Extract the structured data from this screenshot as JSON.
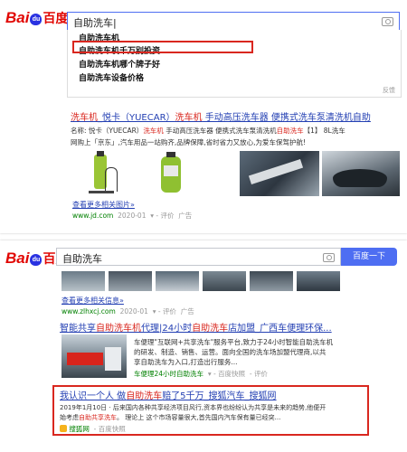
{
  "brand": {
    "latin": "Bai",
    "paw": "du",
    "cn": "百度"
  },
  "panel1": {
    "search_value": "自助洗车|",
    "suggestions": [
      "自助洗车机",
      "自助洗车机千万别投资",
      "自助洗车机哪个牌子好",
      "自助洗车设备价格"
    ],
    "feedback": "反馈",
    "result": {
      "title_red1": "洗车机",
      "title_mid": "_悦卡（YUECAR）",
      "title_red2": "洗车机",
      "title_tail": " 手动高压洗车器 便携式洗车泵清洗机自助",
      "snippet1_a": "名称: 悦卡（YUECAR）",
      "snippet1_red": "洗车机",
      "snippet1_b": " 手动高压洗车器 便携式洗车泵清洗机",
      "snippet1_red2": "自助洗车",
      "snippet1_c": "【1】 8L洗车",
      "snippet2": "网购上「京东」,汽车用品一站购齐,品牌保障,省时省力又放心,为爱车保驾护航!",
      "more_images": "查看更多相关图片»",
      "url": "www.jd.com",
      "date": "2020-01",
      "rating": "评价",
      "ad": "广告"
    }
  },
  "panel2": {
    "search_value": "自助洗车",
    "search_button": "百度一下",
    "more_info": "查看更多相关信息»",
    "url_top": "www.zlhxcj.com",
    "date_top": "2020-01",
    "rating": "评价",
    "ad": "广告",
    "result2": {
      "title_a": "智能共享",
      "title_red": "自助洗车机",
      "title_b": "代理|24小时",
      "title_red2": "自助洗车",
      "title_c": "店加盟_广西车便理环保...",
      "lines": [
        "车便理\"互联网+共享洗车\"服务平台,致力于24小时智能自助洗车机",
        "的研发、制造、销售、运营。面向全国的洗车场加盟代理商,以共",
        "享自助洗车为入口,打造出行服务..."
      ],
      "link": "车便理24小时自助洗车",
      "snapshot": "百度快照",
      "rating": "评价"
    },
    "result3": {
      "title_a": "我认识一个人 做",
      "title_red": "自助洗车",
      "title_b": "赔了5千万_搜狐汽车_搜狐网",
      "line1": "2019年1月10日 · 后来国内各种共享经济项目风行,资本界也纷纷认为共享是未来的趋势,他便开",
      "line2_a": "始考虑",
      "line2_red": "自助共享洗车",
      "line2_b": "。 理论上 这个市场容量很大,首先国内汽车保有量已经突...",
      "source": "搜狐网",
      "snapshot": "百度快照"
    }
  }
}
